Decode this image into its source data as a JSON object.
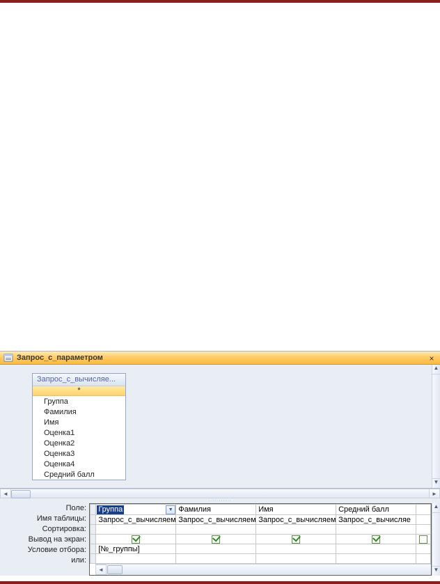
{
  "window": {
    "title": "Запрос_с_параметром",
    "close_glyph": "×"
  },
  "source": {
    "header": "Запрос_с_вычисляе...",
    "all_glyph": "*",
    "fields": [
      "Группа",
      "Фамилия",
      "Имя",
      "Оценка1",
      "Оценка2",
      "Оценка3",
      "Оценка4",
      "Средний балл"
    ]
  },
  "row_labels": {
    "field": "Поле:",
    "table": "Имя таблицы:",
    "sort": "Сортировка:",
    "show": "Вывод на экран:",
    "criteria": "Условие отбора:",
    "or": "или:"
  },
  "grid_columns": [
    {
      "field": "Группа",
      "table": "Запрос_с_вычисляем",
      "show": true,
      "criteria": "[№_группы]",
      "active": true
    },
    {
      "field": "Фамилия",
      "table": "Запрос_с_вычисляем",
      "show": true,
      "criteria": "",
      "active": false
    },
    {
      "field": "Имя",
      "table": "Запрос_с_вычисляем",
      "show": true,
      "criteria": "",
      "active": false
    },
    {
      "field": "Средний балл",
      "table": "Запрос_с_вычисляе",
      "show": true,
      "criteria": "",
      "active": false
    }
  ],
  "splitter_dots": "···········",
  "glyphs": {
    "left": "◄",
    "right": "►",
    "up": "▲",
    "down": "▼",
    "dd": "▼"
  }
}
